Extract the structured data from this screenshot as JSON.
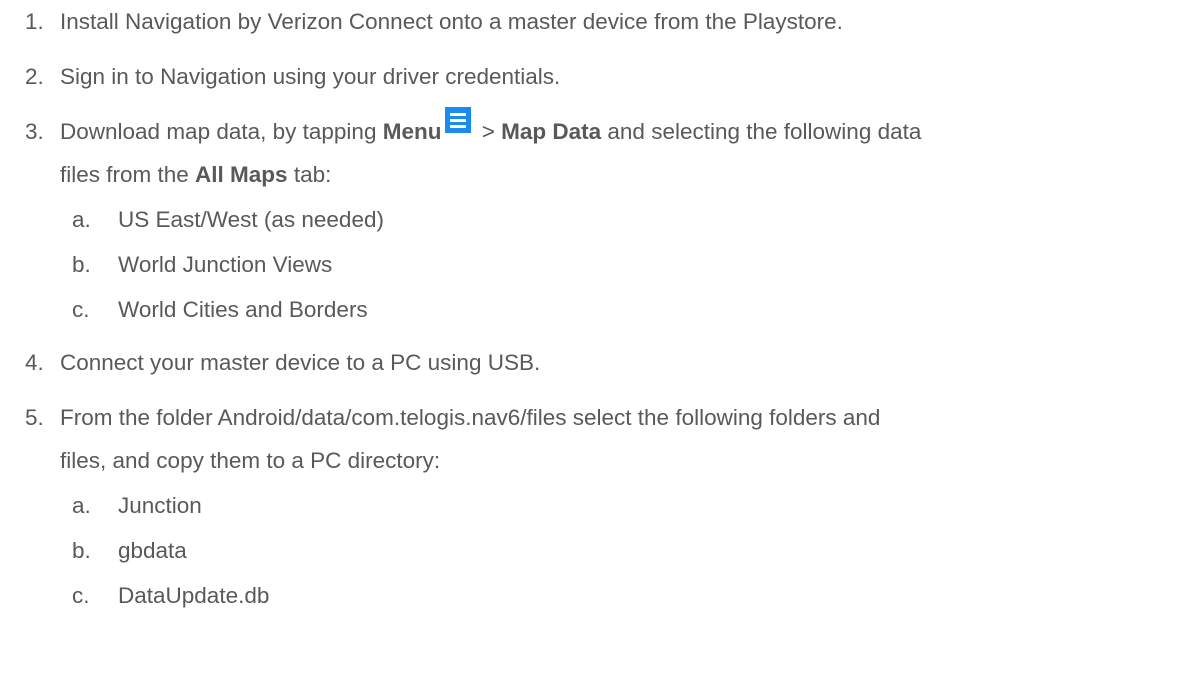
{
  "steps": [
    {
      "num": "1.",
      "text": "Install Navigation by Verizon Connect onto a master device from the Playstore."
    },
    {
      "num": "2.",
      "text": "Sign in to Navigation using your driver credentials."
    },
    {
      "num": "3.",
      "pre": "Download map data, by tapping ",
      "menu": "Menu",
      "sep": " > ",
      "map_data": "Map Data",
      "post": " and selecting the following data",
      "cont_pre": "files from the ",
      "all_maps": "All Maps",
      "cont_post": " tab:",
      "sub": [
        {
          "num": "a.",
          "text": "US East/West (as needed)"
        },
        {
          "num": "b.",
          "text": "World Junction Views"
        },
        {
          "num": "c.",
          "text": "World Cities and Borders"
        }
      ]
    },
    {
      "num": "4.",
      "text": "Connect your master device to a PC using USB."
    },
    {
      "num": "5.",
      "text": "From the folder Android/data/com.telogis.nav6/files select the following folders and",
      "cont": "files, and copy them to a PC directory:",
      "sub": [
        {
          "num": "a.",
          "text": "Junction"
        },
        {
          "num": "b.",
          "text": "gbdata"
        },
        {
          "num": "c.",
          "text": "DataUpdate.db"
        }
      ]
    }
  ],
  "icons": {
    "menu": "hamburger-menu-icon",
    "menu_color": "#1a8cf0"
  }
}
